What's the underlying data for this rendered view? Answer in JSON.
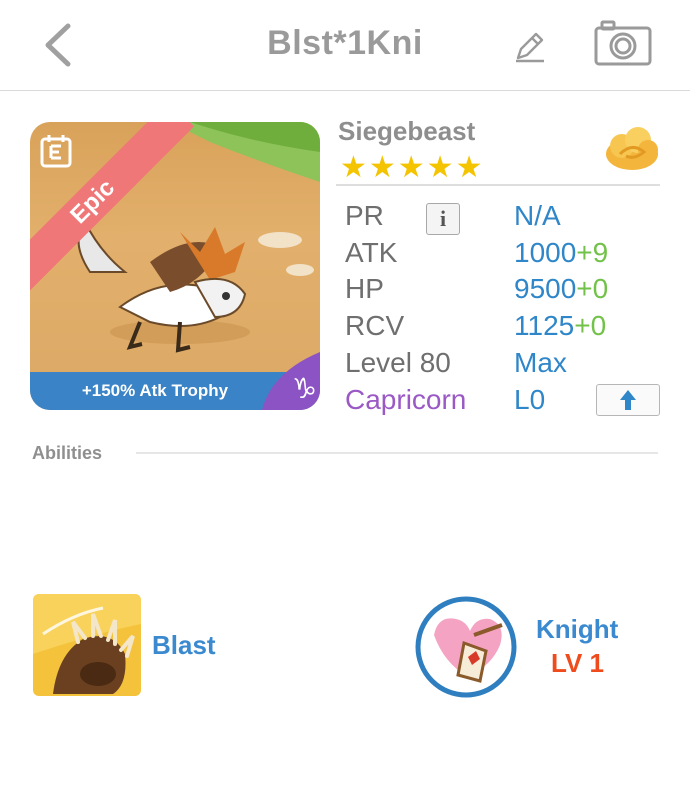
{
  "header": {
    "title": "Blst*1Kni",
    "back_icon": "chevron-left-icon",
    "edit_icon": "pencil-icon",
    "camera_icon": "camera-icon"
  },
  "monster": {
    "name": "Siegebeast",
    "rarity": "Epic",
    "stars": "★★★★★",
    "star_count": 5,
    "trophy": "+150% Atk Trophy",
    "element_icon": "cloud-icon",
    "zodiac_icon": "capricorn-icon",
    "type_badge_icon": "e-calendar-icon"
  },
  "stats": {
    "pr_label": "PR",
    "pr_value": "N/A",
    "atk_label": "ATK",
    "atk_value": "1000",
    "atk_bonus": "+9",
    "hp_label": "HP",
    "hp_value": "9500",
    "hp_bonus": "+0",
    "rcv_label": "RCV",
    "rcv_value": "1125",
    "rcv_bonus": "+0",
    "level_label": "Level 80",
    "level_value": "Max",
    "zodiac_label": "Capricorn",
    "zodiac_value": "L0"
  },
  "abilities": {
    "section_label": "Abilities",
    "items": [
      {
        "label": "Blast",
        "icon": "claw-icon"
      },
      {
        "label": "Knight",
        "level": "LV 1",
        "icon": "heart-shield-icon"
      }
    ]
  },
  "colors": {
    "value_blue": "#2f86c8",
    "bonus_green": "#72c24a",
    "capricorn_purple": "#9a59c5",
    "epic_red": "#ef7777",
    "trophy_bar": "#3a83c6",
    "level_orange": "#ef4b1d"
  }
}
